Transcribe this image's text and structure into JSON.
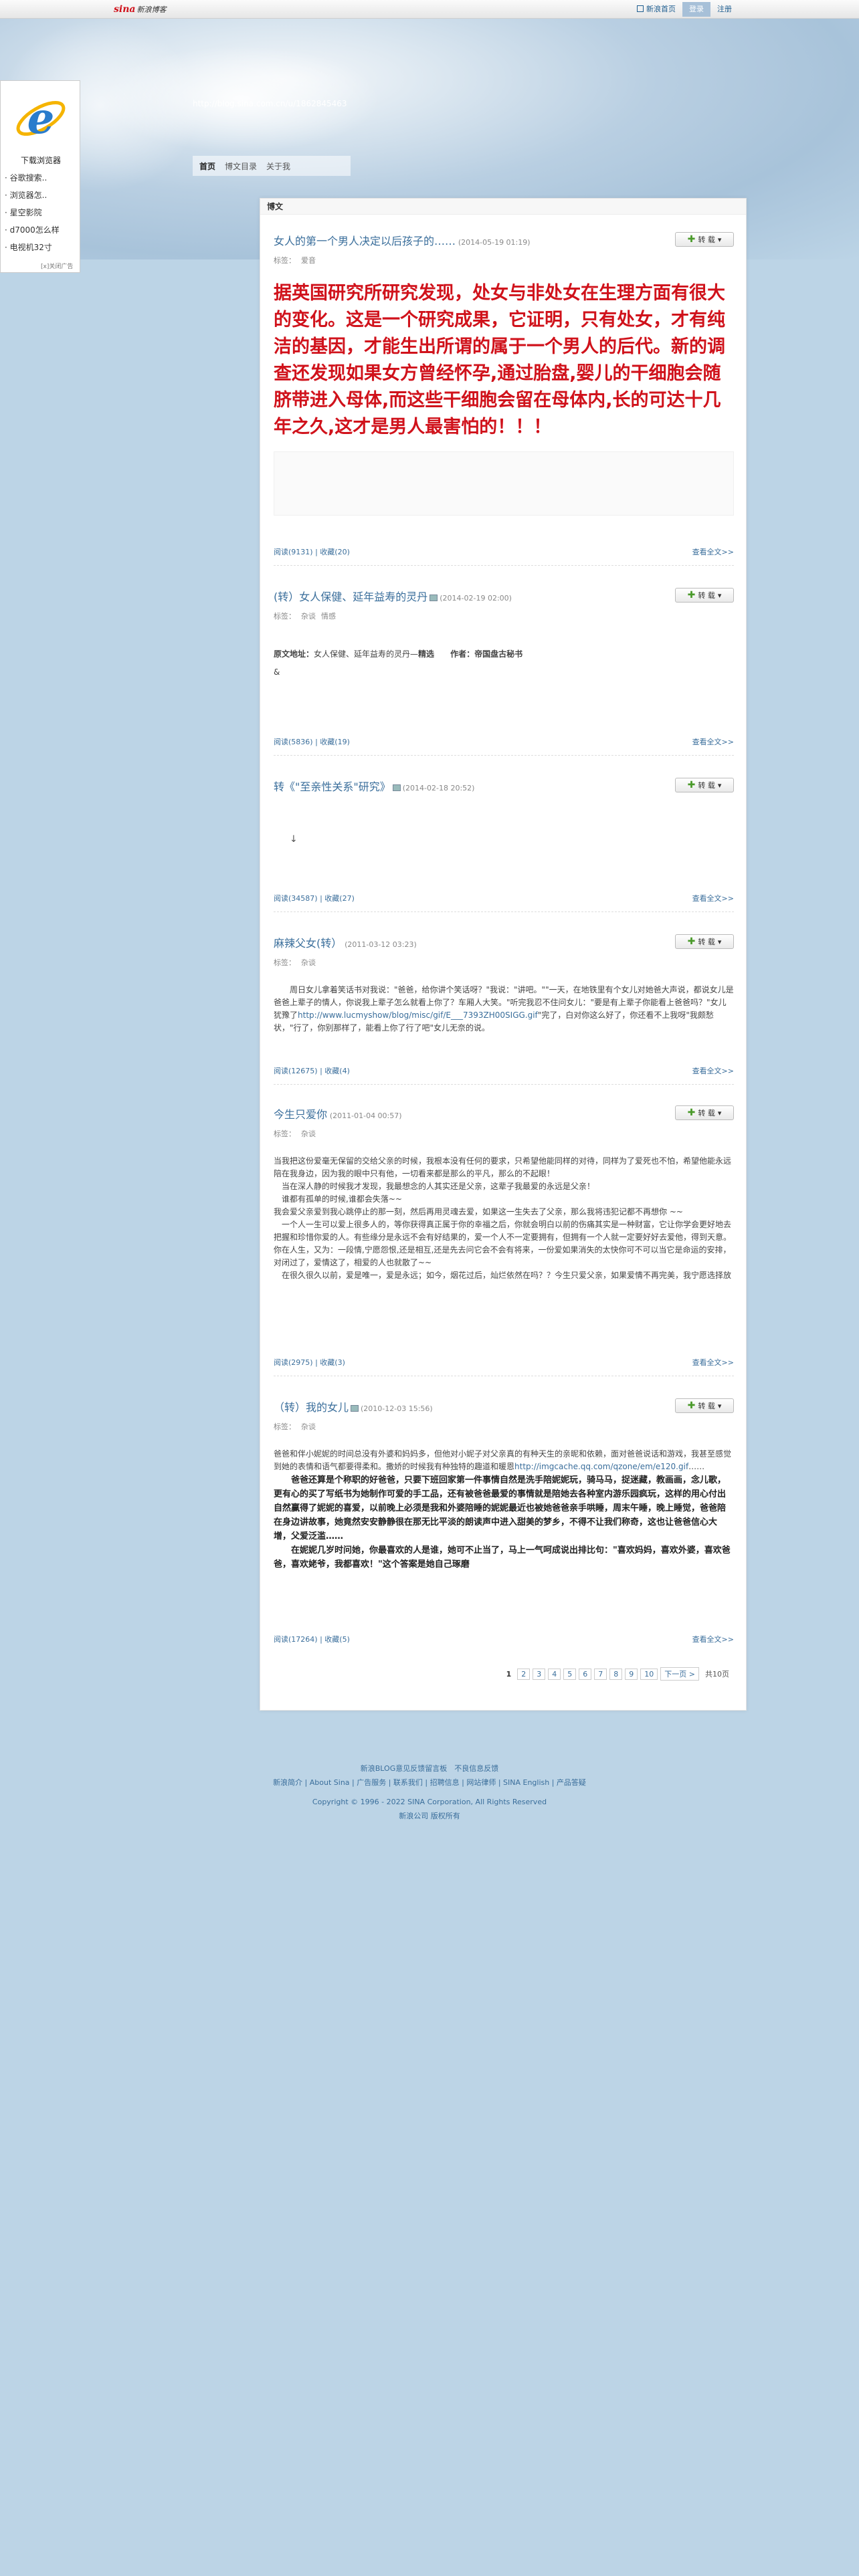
{
  "topbar": {
    "logo_brand": "sina",
    "logo_text": "新浪博客",
    "links": [
      "新浪首页",
      "登录",
      "注册"
    ]
  },
  "header": {
    "url": "http://blog.sina.com.cn/u/1862845463",
    "nav": [
      "首页",
      "博文目录",
      "关于我"
    ]
  },
  "ad": {
    "title": "下载浏览器",
    "items": [
      "谷歌搜索..",
      "浏览器怎..",
      "星空影院",
      "d7000怎么样",
      "电视机32寸"
    ],
    "foot": "[x]关闭广告"
  },
  "main": {
    "head": "博文",
    "repost_label": "转 载",
    "posts": [
      {
        "title": "女人的第一个男人决定以后孩子的……",
        "time": "(2014-05-19 01:19)",
        "tags_label": "标签：",
        "tags": [
          "爱音"
        ],
        "big_text": "据英国研究所研究发现，处女与非处女在生理方面有很大的变化。这是一个研究成果，它证明，只有处女，才有纯洁的基因，才能生出所谓的属于一个男人的后代。新的调查还发现如果女方曾经怀孕,通过胎盘,婴儿的干细胞会随脐带进入母体,而这些干细胞会留在母体内,长的可达十几年之久,这才是男人最害怕的！！！",
        "read": "阅读(9131)",
        "fav": "收藏(20)",
        "more": "查看全文>>"
      },
      {
        "title": "(转）女人保健、延年益寿的灵丹",
        "time": "(2014-02-19 02:00)",
        "tags_label": "标签：",
        "tags": [
          "杂谈",
          "情感"
        ],
        "source_label": "原文地址：",
        "source_text": "女人保健、延年益寿的灵丹",
        "source_tag": "精选",
        "author_label": "作者：",
        "author": "帝国盘古秘书",
        "amp": "&",
        "read": "阅读(5836)",
        "fav": "收藏(19)",
        "more": "查看全文>>"
      },
      {
        "title": "转《\"至亲性关系\"研究》",
        "time": "(2014-02-18 20:52)",
        "cursor": "↓",
        "read": "阅读(34587)",
        "fav": "收藏(27)",
        "more": "查看全文>>"
      },
      {
        "title": "麻辣父女(转）",
        "time": "(2011-03-12 03:23)",
        "tags_label": "标签：",
        "tags": [
          "杂谈"
        ],
        "body_1": "周日女儿拿着笑话书对我说：\"爸爸，给你讲个笑话呀？\"我说：\"讲吧。\"\"一天，在地铁里有个女儿对她爸大声说，都说女儿是爸爸上辈子的情人，你说我上辈子怎么就看上你了？车厢人大笑。\"听完我忍不住问女儿：\"要是有上辈子你能看上爸爸吗？\"女儿犹豫了",
        "body_link": "http://www.lucmyshow/blog/misc/gif/E___7393ZH00SIGG.gif",
        "body_2": "\"完了，白对你这么好了，你还看不上我呀\"我颇愁状，\"行了，你别那样了，能看上你了行了吧\"女儿无奈的说。",
        "read": "阅读(12675)",
        "fav": "收藏(4)",
        "more": "查看全文>>"
      },
      {
        "title": "今生只爱你",
        "time": "(2011-01-04 00:57)",
        "tags_label": "标签：",
        "tags": [
          "杂谈"
        ],
        "lines": [
          "当我把这份爱毫无保留的交给父亲的时候，我根本没有任何的要求，只希望他能同样的对待，同样为了爱死也不怕，希望他能永远陪在我身边，因为我的眼中只有他，一切看来都是那么的平凡，那么的不起眼！",
          "　当在深人静的时候我才发现，我最想念的人其实还是父亲，这辈子我最爱的永远是父亲！",
          "　谁都有孤单的时候,谁都会失落~~",
          "我会爱父亲爱到我心跳停止的那一刻，然后再用灵魂去爱，如果这一生失去了父亲，那么我将违犯记都不再想你 ~~",
          "　一个人一生可以爱上很多人的，等你获得真正属于你的幸福之后，你就会明白以前的伤痛其实是一种财富，它让你学会更好地去把握和珍惜你爱的人。有些缘分是永远不会有好结果的，爱一个人不一定要拥有，但拥有一个人就一定要好好去爱他，得到天意。你在人生，又为：一段情,宁愿怨恨,还是相互,还是先去问它会不会有将来，一份爱如果消失的太快你可不可以当它是命运的安排，对闭过了，爱情这了，相爱的人也就散了~~",
          "　在很久很久以前，爱是唯一，爱是永远；如今，烟花过后，灿烂依然在吗？？今生只爱父亲，如果爱情不再完美，我宁愿选择放"
        ],
        "read": "阅读(2975)",
        "fav": "收藏(3)",
        "more": "查看全文>>"
      },
      {
        "title": "（转）我的女儿",
        "time": "(2010-12-03 15:56)",
        "tags_label": "标签：",
        "tags": [
          "杂谈"
        ],
        "body_1": "爸爸和伴小妮妮的时间总没有外婆和妈妈多，但他对小妮子对父亲真的有种天生的亲昵和依赖，面对爸爸说话和游戏，我甚至感觉到她的表情和语气都要得柔和。撒娇的时候我有种独特的趣道和暖恩",
        "body_link": "http://imgcache.qq.com/qzone/em/e120.gif",
        "body_2": "……",
        "bold_1": "　　爸爸还算是个称职的好爸爸，只要下班回家第一件事情自然是洗手陪妮妮玩，骑马马，捉迷藏，教画画，念儿歌，更有心的买了写纸书为她制作可爱的手工品，还有被爸爸最爱的事情就是陪她去各种室内游乐园疯玩，这样的用心付出自然赢得了妮妮的喜爱，以前晚上必须是我和外婆陪睡的妮妮最近也被她爸爸亲手哄睡，周末午睡，晚上睡觉，爸爸陪在身边讲故事，她竟然安安静静很在那无比平淡的朗读声中进入甜美的梦乡，不得不让我们称奇，这也让爸爸信心大增，父爱泛滥……",
        "bold_2": "　　在妮妮几岁时问她，你最喜欢的人是谁，她可不止当了，马上一气呵成说出排比句：\"喜欢妈妈，喜欢外婆，喜欢爸爸，喜欢姥爷，我都喜欢！\"这个答案是她自己琢磨",
        "read": "阅读(17264)",
        "fav": "收藏(5)",
        "more": "查看全文>>"
      }
    ],
    "pager": {
      "current": "1",
      "pages": [
        "2",
        "3",
        "4",
        "5",
        "6",
        "7",
        "8",
        "9",
        "10"
      ],
      "next": "下一页 >",
      "total": "共10页"
    }
  },
  "footer": {
    "line1": "新浪BLOG意见反馈留言板　不良信息反馈",
    "line2": "新浪简介 | About Sina | 广告服务 | 联系我们 | 招聘信息 | 网站律师 | SINA English | 产品答疑",
    "line3": "Copyright © 1996 - 2022 SINA Corporation, All Rights Reserved",
    "line4": "新浪公司 版权所有"
  }
}
